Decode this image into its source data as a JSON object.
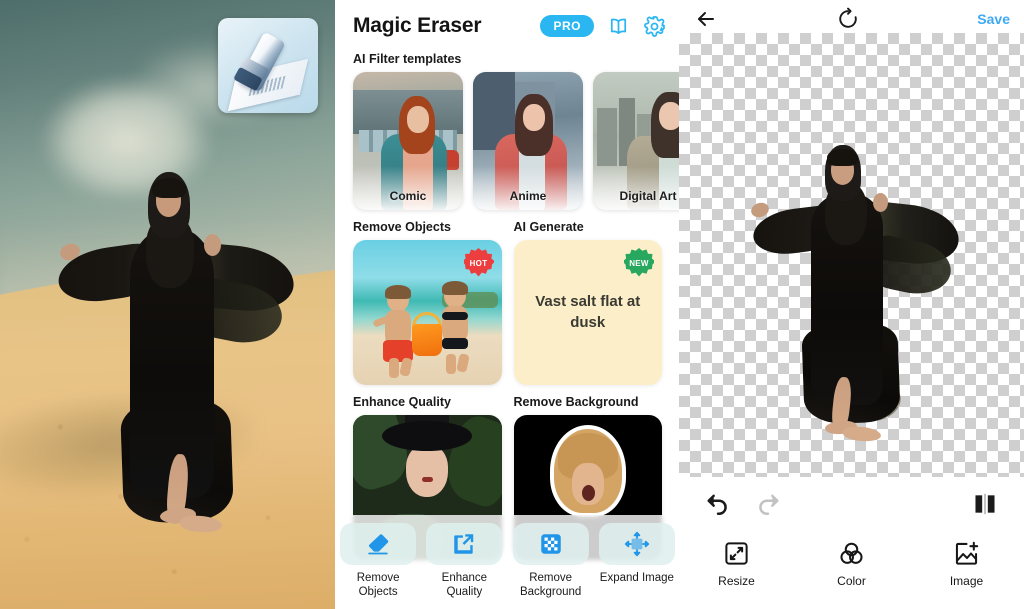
{
  "left_panel": {
    "name": "source-photo",
    "description": "Woman in flowing black dress walking barefoot on a desert sand dune with pyramid",
    "app_icon": {
      "name": "magic-eraser-app-icon",
      "alt": "Eraser on photo card"
    }
  },
  "middle_panel": {
    "header": {
      "title": "Magic Eraser",
      "pro_label": "PRO",
      "icons": [
        {
          "name": "book-icon",
          "label": "Tutorial"
        },
        {
          "name": "gear-icon",
          "label": "Settings"
        }
      ]
    },
    "sections": {
      "ai_filter_templates": {
        "label": "AI Filter templates",
        "cards": [
          {
            "name": "Comic"
          },
          {
            "name": "Anime"
          },
          {
            "name": "Digital Art"
          }
        ]
      },
      "remove_objects": {
        "label": "Remove Objects",
        "badge": "HOT"
      },
      "ai_generate": {
        "label": "AI Generate",
        "badge": "NEW",
        "prompt": "Vast salt flat at dusk"
      },
      "enhance_quality": {
        "label": "Enhance Quality"
      },
      "remove_background": {
        "label": "Remove Background"
      }
    },
    "bottom_toolbar": [
      {
        "label": "Remove\nObjects",
        "line1": "Remove",
        "line2": "Objects",
        "icon": "eraser-icon"
      },
      {
        "label": "Enhance\nQuality",
        "line1": "Enhance",
        "line2": "Quality",
        "icon": "enhance-icon"
      },
      {
        "label": "Remove\nBackground",
        "line1": "Remove",
        "line2": "Background",
        "icon": "remove-background-icon"
      },
      {
        "label": "Expand Image",
        "line1": "Expand Image",
        "line2": "",
        "icon": "expand-image-icon"
      }
    ]
  },
  "right_panel": {
    "header": {
      "back_icon": "back-arrow-icon",
      "reset_icon": "reset-rotate-icon",
      "save_label": "Save"
    },
    "canvas": {
      "name": "transparent-canvas",
      "content": "Cut-out of woman in black dress on transparency checkerboard"
    },
    "history": {
      "undo_icon": "undo-icon",
      "redo_icon": "redo-icon",
      "redo_disabled": true,
      "compare_icon": "compare-split-icon"
    },
    "tools": [
      {
        "label": "Resize",
        "icon": "resize-icon"
      },
      {
        "label": "Color",
        "icon": "color-icon"
      },
      {
        "label": "Image",
        "icon": "add-image-icon"
      }
    ]
  },
  "colors": {
    "accent_blue": "#29b6f1",
    "save_blue": "#3fa9f5",
    "hot_red": "#ec3e3e",
    "new_green": "#27a85e",
    "ai_generate_bg": "#fbeec9"
  }
}
